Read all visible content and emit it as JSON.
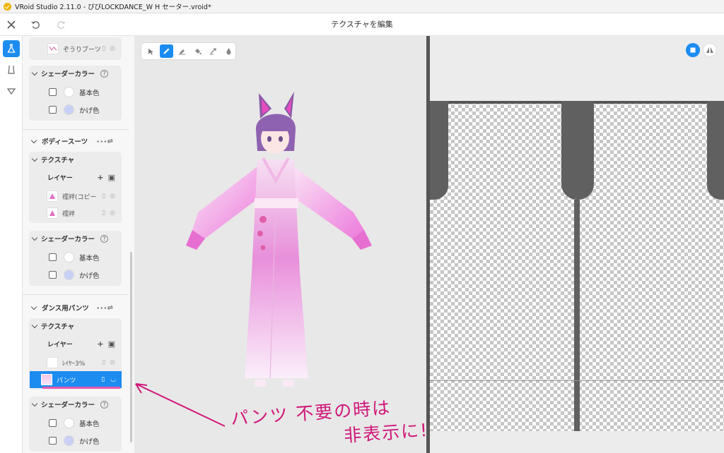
{
  "window": {
    "title": "VRoid Studio 2.11.0 - ぴぴLOCKDANCE_W H セーター.vroid*"
  },
  "header": {
    "title": "テクスチャを編集"
  },
  "panel": {
    "top_item": {
      "label": "ぞうりブーツ"
    },
    "shader1": {
      "title": "シェーダーカラー",
      "base": "基本色",
      "shade": "かげ色"
    },
    "bodysuit": {
      "title": "ボディースーツ",
      "texture_title": "テクスチャ",
      "layer_label": "レイヤー",
      "layers": [
        "襦袢(コピー",
        "襦袢"
      ]
    },
    "shader2": {
      "title": "シェーダーカラー",
      "base": "基本色",
      "shade": "かげ色"
    },
    "dance_pants": {
      "title": "ダンス用パンツ",
      "texture_title": "テクスチャ",
      "layer_label": "レイヤー",
      "layers": [
        "ﾚｲﾔｰ3%",
        "パンツ"
      ]
    },
    "shader3": {
      "title": "シェーダーカラー",
      "base": "基本色",
      "shade": "かげ色"
    }
  },
  "annotation": {
    "line1": "パンツ 不要の時は",
    "line2": "非表示に!"
  },
  "colors": {
    "accent": "#1c8cf0",
    "annotation": "#d0187a",
    "shade_swatch": "#c9d0f5",
    "base_swatch": "#ffffff"
  },
  "icons": [
    "close-icon",
    "undo-icon",
    "redo-icon",
    "body-icon",
    "clothing-icon",
    "accessory-icon",
    "select-icon",
    "pen-icon",
    "eraser-icon",
    "fill-icon",
    "stamp-icon",
    "dropper-icon"
  ]
}
